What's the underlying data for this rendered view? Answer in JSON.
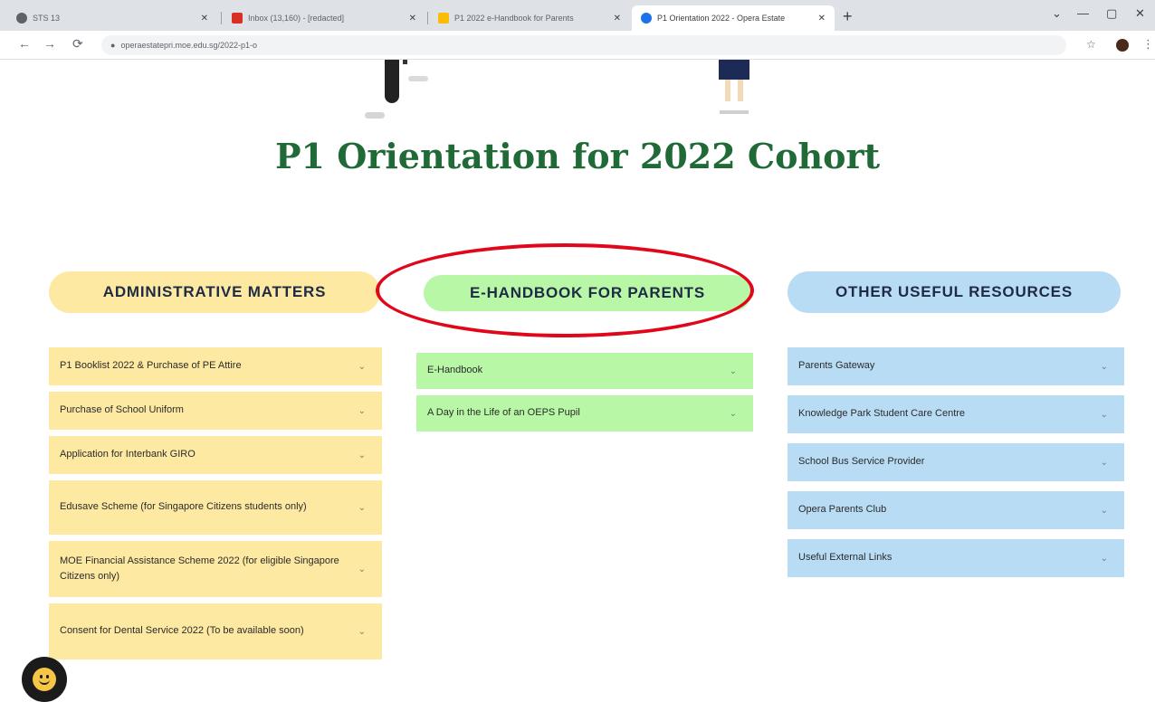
{
  "browser": {
    "tabs": [
      {
        "title": "STS 13",
        "favicon_color": "#5f6368",
        "active": false
      },
      {
        "title": "Inbox (13,160) - [redacted]",
        "favicon_color": "#d93025",
        "active": false
      },
      {
        "title": "P1 2022 e-Handbook for Parents",
        "favicon_color": "#fbbc04",
        "active": false
      },
      {
        "title": "P1 Orientation 2022 - Opera Estate",
        "favicon_color": "#1a73e8",
        "active": true
      }
    ],
    "new_tab_glyph": "+",
    "url": "operaestatepri.moe.edu.sg/2022-p1-o",
    "back_glyph": "←",
    "forward_glyph": "→",
    "reload_glyph": "⟳",
    "lock_glyph": "●",
    "star_glyph": "☆",
    "menu_glyph": "⋮",
    "win_min": "—",
    "win_max": "▢",
    "win_close": "✕",
    "tab_close": "✕",
    "tabs_menu": "⌄"
  },
  "page": {
    "title": "P1 Orientation for 2022 Cohort",
    "columns": {
      "admin": {
        "heading": "ADMINISTRATIVE MATTERS",
        "items": [
          "P1 Booklist 2022 & Purchase of PE Attire",
          "Purchase of School Uniform",
          "Application for Interbank GIRO",
          "Edusave Scheme (for Singapore Citizens students only)",
          "MOE Financial Assistance Scheme 2022 (for eligible Singapore Citizens only)",
          "Consent for Dental Service 2022 (To be available soon)"
        ]
      },
      "handbook": {
        "heading": "E-HANDBOOK FOR PARENTS",
        "items": [
          "E-Handbook",
          "A Day in the Life of an OEPS Pupil"
        ]
      },
      "resources": {
        "heading": "OTHER USEFUL RESOURCES",
        "items": [
          "Parents Gateway",
          "Knowledge Park Student Care Centre",
          "School Bus Service Provider",
          "Opera Parents Club",
          "Useful External Links"
        ]
      }
    },
    "chevron_glyph": "⌄",
    "colors": {
      "title": "#1f6a36",
      "admin": "#fde9a2",
      "handbook": "#b7f7a5",
      "resources": "#b9dcf5",
      "highlight_ring": "#e1061a"
    }
  }
}
